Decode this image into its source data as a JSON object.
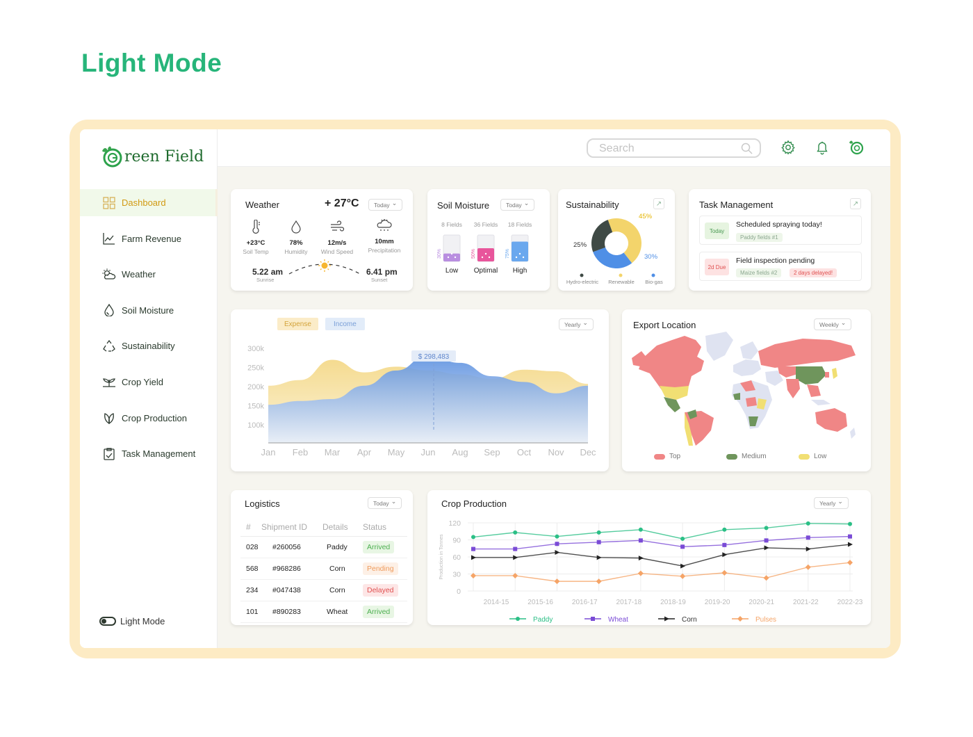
{
  "page_heading": "Light Mode",
  "brand": {
    "name": "reen Field",
    "accent": "#27b57a"
  },
  "sidebar": {
    "items": [
      {
        "label": "Dashboard",
        "icon": "grid-icon",
        "active": true
      },
      {
        "label": "Farm Revenue",
        "icon": "trend-icon"
      },
      {
        "label": "Weather",
        "icon": "cloud-sun-icon"
      },
      {
        "label": "Soil Moisture",
        "icon": "drop-icon"
      },
      {
        "label": "Sustainability",
        "icon": "recycle-icon"
      },
      {
        "label": "Crop Yield",
        "icon": "sprout-icon"
      },
      {
        "label": "Crop Production",
        "icon": "leaf-icon"
      },
      {
        "label": "Task Management",
        "icon": "clipboard-icon"
      }
    ],
    "mode_label": "Light Mode"
  },
  "topbar": {
    "search_placeholder": "Search"
  },
  "weather": {
    "title": "Weather",
    "temp": "+ 27°C",
    "range": "Today",
    "stats": [
      {
        "value": "+23°C",
        "label": "Soil Temp"
      },
      {
        "value": "78%",
        "label": "Humidity"
      },
      {
        "value": "12m/s",
        "label": "Wind Speed"
      },
      {
        "value": "10mm",
        "label": "Precipitation"
      }
    ],
    "sunrise": {
      "time": "5.22 am",
      "label": "Sunrise"
    },
    "sunset": {
      "time": "6.41 pm",
      "label": "Sunset"
    }
  },
  "soil": {
    "title": "Soil Moisture",
    "range": "Today",
    "bars": [
      {
        "fields": "8 Fields",
        "pct": "30%",
        "label": "Low",
        "color": "#b98ee0"
      },
      {
        "fields": "36 Fields",
        "pct": "50%",
        "label": "Optimal",
        "color": "#e8559b"
      },
      {
        "fields": "18 Fields",
        "pct": "75%",
        "label": "High",
        "color": "#6aa8ee"
      }
    ]
  },
  "sustainability": {
    "title": "Sustainability",
    "slices": [
      {
        "name": "Hydro-electric",
        "pct": "25%",
        "value": 25,
        "color": "#3f4a45"
      },
      {
        "name": "Renewable",
        "pct": "45%",
        "value": 45,
        "color": "#f3d46b"
      },
      {
        "name": "Bio-gas",
        "pct": "30%",
        "value": 30,
        "color": "#4f8fe6"
      }
    ]
  },
  "tasks": {
    "title": "Task Management",
    "items": [
      {
        "badge": "Today",
        "title": "Scheduled spraying today!",
        "tags": [
          "Paddy fields #1"
        ]
      },
      {
        "badge": "2d Due",
        "title": "Field inspection pending",
        "tags": [
          "Maize fields #2",
          "2 days delayed!"
        ]
      }
    ]
  },
  "revenue": {
    "tabs": [
      "Expense",
      "Income"
    ],
    "range": "Yearly",
    "tooltip": "$ 298,483"
  },
  "export": {
    "title": "Export Location",
    "range": "Weekly",
    "legend": [
      {
        "label": "Top",
        "color": "#f08686"
      },
      {
        "label": "Medium",
        "color": "#6f955c"
      },
      {
        "label": "Low",
        "color": "#f1df73"
      }
    ]
  },
  "logistics": {
    "title": "Logistics",
    "range": "Today",
    "columns": [
      "#",
      "Shipment ID",
      "Details",
      "Status"
    ],
    "rows": [
      {
        "n": "028",
        "id": "#260056",
        "details": "Paddy",
        "status": "Arrived"
      },
      {
        "n": "568",
        "id": "#968286",
        "details": "Corn",
        "status": "Pending"
      },
      {
        "n": "234",
        "id": "#047438",
        "details": "Corn",
        "status": "Delayed"
      },
      {
        "n": "101",
        "id": "#890283",
        "details": "Wheat",
        "status": "Arrived"
      }
    ]
  },
  "chart_data": [
    {
      "type": "area",
      "categories": [
        "Jan",
        "Feb",
        "Mar",
        "Apr",
        "May",
        "Jun",
        "Aug",
        "Sep",
        "Oct",
        "Nov",
        "Dec"
      ],
      "y_ticks": [
        "300k",
        "250k",
        "200k",
        "150k",
        "100k"
      ],
      "ylim": [
        50000,
        300000
      ],
      "series": [
        {
          "name": "Expense",
          "color": "#f5de9a",
          "values": [
            200000,
            215000,
            268000,
            235000,
            250000,
            240000,
            230000,
            218000,
            242000,
            238000,
            205000
          ]
        },
        {
          "name": "Income",
          "color": "#5a8fdf",
          "values": [
            150000,
            160000,
            165000,
            200000,
            240000,
            280000,
            260000,
            225000,
            210000,
            180000,
            200000
          ]
        }
      ],
      "annotation": {
        "label": "$ 298,483",
        "category": "Jun"
      }
    },
    {
      "type": "line",
      "title": "Crop Production",
      "range": "Yearly",
      "ylabel": "Production in Tonnes",
      "y_ticks": [
        120,
        90,
        60,
        30,
        0
      ],
      "ylim": [
        0,
        120
      ],
      "categories": [
        "2014-15",
        "2015-16",
        "2016-17",
        "2017-18",
        "2018-19",
        "2019-20",
        "2020-21",
        "2021-22",
        "2022-23"
      ],
      "series": [
        {
          "name": "Paddy",
          "color": "#2bbf86",
          "marker": "circle",
          "values": [
            95,
            103,
            96,
            103,
            108,
            92,
            108,
            111,
            119,
            118
          ]
        },
        {
          "name": "Wheat",
          "color": "#7a4bd6",
          "marker": "square",
          "values": [
            74,
            74,
            83,
            86,
            89,
            78,
            81,
            89,
            94,
            96
          ]
        },
        {
          "name": "Corn",
          "color": "#222222",
          "marker": "triangle",
          "values": [
            59,
            59,
            68,
            59,
            58,
            44,
            64,
            76,
            74,
            82
          ]
        },
        {
          "name": "Pulses",
          "color": "#f5a467",
          "marker": "diamond",
          "values": [
            27,
            27,
            17,
            17,
            31,
            26,
            32,
            23,
            42,
            50
          ]
        }
      ]
    }
  ]
}
